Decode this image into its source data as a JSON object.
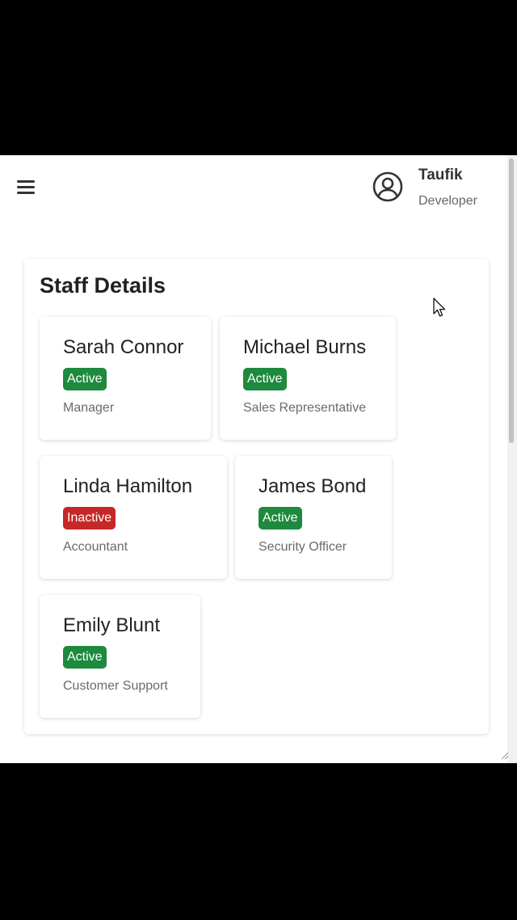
{
  "header": {
    "menu_icon": "hamburger-menu-icon",
    "avatar_icon": "user-circle-icon",
    "user_name": "Taufik",
    "user_role": "Developer"
  },
  "main": {
    "title": "Staff Details",
    "staff": [
      {
        "name": "Sarah Connor",
        "status": "Active",
        "role": "Manager"
      },
      {
        "name": "Michael Burns",
        "status": "Active",
        "role": "Sales Representative"
      },
      {
        "name": "Linda Hamilton",
        "status": "Inactive",
        "role": "Accountant"
      },
      {
        "name": "James Bond",
        "status": "Active",
        "role": "Security Officer"
      },
      {
        "name": "Emily Blunt",
        "status": "Active",
        "role": "Customer Support"
      }
    ]
  },
  "colors": {
    "active_badge": "#1e8a3e",
    "inactive_badge": "#c62828",
    "text_primary": "#222222",
    "text_secondary": "#6b6b6b"
  }
}
